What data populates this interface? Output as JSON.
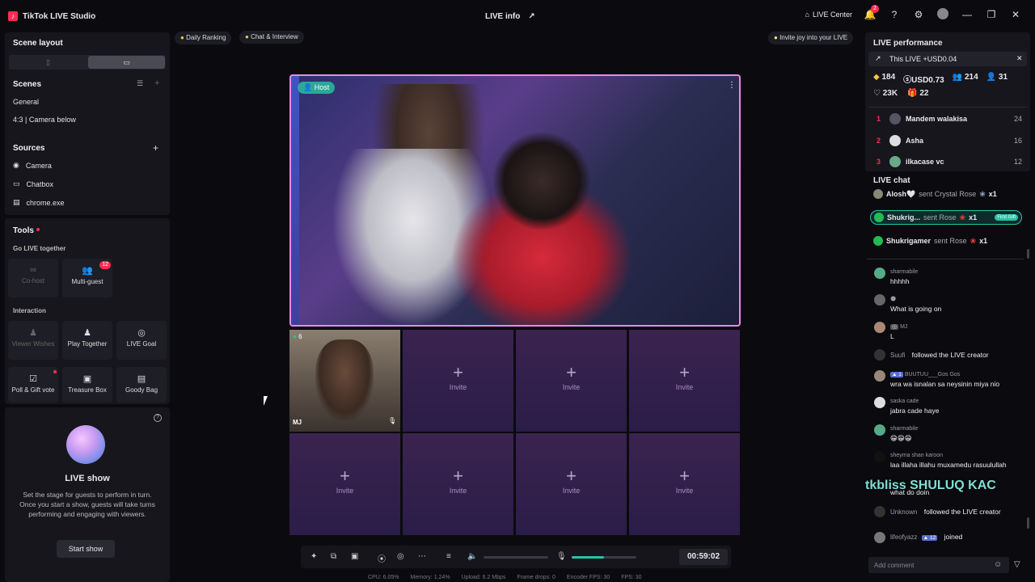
{
  "app": {
    "title": "TikTok LIVE Studio",
    "center_title": "LIVE info",
    "live_center": "LIVE Center",
    "notif_count": "2"
  },
  "left": {
    "scene_layout": "Scene layout",
    "scenes_title": "Scenes",
    "scenes": [
      "General",
      "4:3 | Camera below"
    ],
    "sources_title": "Sources",
    "sources": [
      "Camera",
      "Chatbox",
      "chrome.exe"
    ],
    "tools_title": "Tools",
    "go_live_together": "Go LIVE together",
    "cohost": "Co-host",
    "multiguest": "Multi-guest",
    "multiguest_badge": "12",
    "interaction": "Interaction",
    "viewer_wishes": "Viewer Wishes",
    "play_together": "Play Together",
    "live_goal": "LIVE Goal",
    "poll": "Poll & Gift vote",
    "treasure": "Treasure Box",
    "goody": "Goody Bag",
    "live_show_title": "LIVE show",
    "live_show_desc": "Set the stage for guests to perform in turn. Once you start a show, guests will take turns performing and engaging with viewers.",
    "start_show": "Start show"
  },
  "top_pills": {
    "daily_ranking": "Daily Ranking",
    "chat_interview": "Chat & Interview",
    "invite_joy": "Invite joy into your LIVE"
  },
  "stage": {
    "host_label": "Host",
    "guest_count": "6",
    "guest_initials": "MJ",
    "invite": "Invite"
  },
  "controls": {
    "timer": "00:59:02"
  },
  "status": {
    "cpu": "CPU: 6.05%",
    "memory": "Memory: 1.24%",
    "upload": "Upload: 6.2 Mbps",
    "frame_drops": "Frame drops: 0",
    "encoder_fps": "Encoder FPS: 30",
    "fps": "FPS: 30"
  },
  "performance": {
    "title": "LIVE performance",
    "banner": "This LIVE +USD0.04",
    "diamonds": "184",
    "usd": "USD0.73",
    "viewers": "214",
    "new_followers": "31",
    "likes": "23K",
    "gifters": "22",
    "ranking": [
      {
        "rank": "1",
        "name": "Mandem walakisa",
        "score": "24"
      },
      {
        "rank": "2",
        "name": "Asha",
        "score": "16"
      },
      {
        "rank": "3",
        "name": "ilkacase vc",
        "score": "12"
      }
    ]
  },
  "chat": {
    "title": "LIVE chat",
    "gift1_name": "Alosh🤍",
    "gift1_text": "sent Crystal Rose",
    "gift1_count": "x1",
    "gift2_name": "Shukrig...",
    "gift2_text": "sent Rose",
    "gift2_count": "x1",
    "gift2_badge": "First Gift",
    "gift3_name": "Shukrigamer",
    "gift3_text": "sent Rose",
    "gift3_count": "x1",
    "messages": [
      {
        "name": "sharmabile",
        "text": "hhhhh"
      },
      {
        "name": "🌑",
        "text": "What is going on"
      },
      {
        "name": "MJ",
        "text": "L"
      },
      {
        "name": "Suufi",
        "text": "followed the LIVE creator"
      },
      {
        "name": "BUUTUU___Gos Gos",
        "text": "wra wa isnalan sa neysinin miya nio"
      },
      {
        "name": "saska cade",
        "text": "jabra cade haye"
      },
      {
        "name": "sharmabile",
        "text": "😁😁😁"
      },
      {
        "name": "sheyma shan karoon",
        "text": "laa illaha illahu muxamedu rasuulullah"
      },
      {
        "name": "",
        "text": "what do doin"
      },
      {
        "name": "Unknown",
        "text": "followed the LIVE creator"
      },
      {
        "name": "lifeofyazz",
        "text": "joined"
      }
    ],
    "badge_buutuu": "1",
    "badge_lifeofyazz": "12",
    "overlay": "tkbliss SHULUQ KAC",
    "add_comment": "Add comment"
  },
  "colors": {
    "accent": "#fe2c55",
    "teal": "#25c4a8",
    "frame": "#e889e6"
  }
}
